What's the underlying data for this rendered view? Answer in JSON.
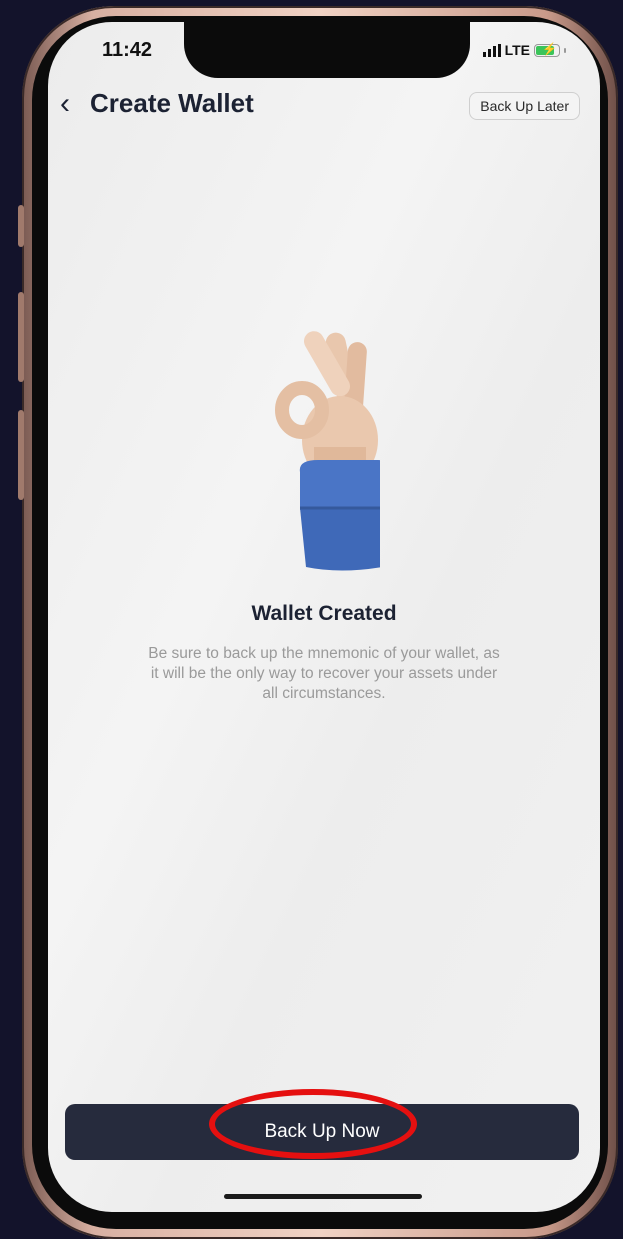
{
  "status_bar": {
    "time": "11:42",
    "network": "LTE"
  },
  "header": {
    "back_icon": "chevron-left-icon",
    "title": "Create Wallet",
    "back_up_later_label": "Back Up Later"
  },
  "content": {
    "illustration": "ok-hand-gesture",
    "heading": "Wallet Created",
    "description": "Be sure to back up the mnemonic of your wallet, as it will be the only way to recover your assets under all circumstances."
  },
  "footer": {
    "back_up_now_label": "Back Up Now"
  },
  "colors": {
    "primary_button": "#262b3d",
    "highlight_ring": "#e51010",
    "battery": "#3bc45a"
  }
}
